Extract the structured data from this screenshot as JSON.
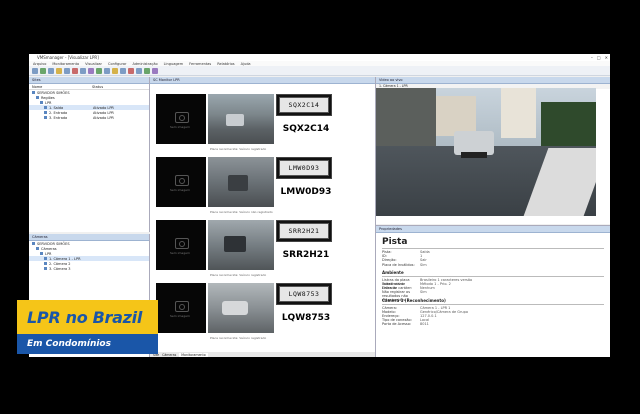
{
  "window": {
    "title": "VMSmanager - [Visualizar LPR]"
  },
  "menu": [
    "Arquivo",
    "Monitoramento",
    "Visualizar",
    "Configurar",
    "Administração",
    "Linguagem",
    "Ferramentas",
    "Relatórios",
    "Ajuda"
  ],
  "left_top": {
    "title": "Sites",
    "columns": [
      "Nome",
      "Status"
    ],
    "rows": [
      {
        "label": "SERVIDOR SIMÕES",
        "status": ""
      },
      {
        "label": "Regiões",
        "status": ""
      },
      {
        "label": "LPR",
        "status": ""
      },
      {
        "label": "1. Saída",
        "status": "Ativado LPR"
      },
      {
        "label": "2. Entrada",
        "status": "Ativado LPR"
      },
      {
        "label": "3. Entrada",
        "status": "Ativado LPR"
      }
    ]
  },
  "left_bottom": {
    "title": "Câmeras",
    "rows": [
      {
        "label": "SERVIDOR SIMÕES"
      },
      {
        "label": "Câmeras"
      },
      {
        "label": "LPR"
      },
      {
        "label": "1. Câmera 1 - LPR"
      },
      {
        "label": "2. Câmera 2"
      },
      {
        "label": "3. Câmera 3"
      }
    ]
  },
  "center": {
    "title": "SC Monitor LPR",
    "entries": [
      {
        "plate": "SQX2C14",
        "caption": "Placa reconhecida: Veículo registrado"
      },
      {
        "plate": "LMW0D93",
        "caption": "Placa reconhecida: Veículo não registrado"
      },
      {
        "plate": "SRR2H21",
        "caption": "Placa reconhecida: Veículo registrado"
      },
      {
        "plate": "LQW8753",
        "caption": "Placa reconhecida: Veículo registrado"
      }
    ],
    "no_image": "Sem imagem",
    "tabs": [
      "Site",
      "Câmeras",
      "Monitoramento"
    ]
  },
  "video": {
    "title": "Video ao vivo",
    "camera_label": "1. Câmera 1 - LPR"
  },
  "props": {
    "header": "Propriedades",
    "title": "Pista",
    "rows1": [
      [
        "Pista:",
        "Saída"
      ],
      [
        "ID:",
        "1"
      ],
      [
        "Direção:",
        "Sair"
      ],
      [
        "Placa de Inválidos:",
        "Sim"
      ]
    ],
    "section2": "Ambiente",
    "rows2": [
      [
        "Listras da placa cadastradas:",
        "Brasileiro 1 caracteres versão"
      ],
      [
        "Tolerância de Entrada:",
        "Método 1 - Prio. 2"
      ],
      [
        "Listra de caráter:",
        "Nenhum"
      ],
      [
        "Não registrar os resultados não reconhecidos:",
        "Sim"
      ]
    ],
    "section3": "Câmera 1 (Reconhecimento)",
    "rows3": [
      [
        "Câmera:",
        "Câmera 1 - LPR 1"
      ],
      [
        "Modelo:",
        "Genérico/Câmera de Grupo"
      ],
      [
        "Endereço:",
        "127.0.0.1"
      ],
      [
        "Tipo de conexão:",
        "Local"
      ],
      [
        "Porta de Acesso:",
        "8011"
      ]
    ]
  },
  "banner": {
    "line1": "LPR no Brazil",
    "line2": "Em Condomínios"
  }
}
